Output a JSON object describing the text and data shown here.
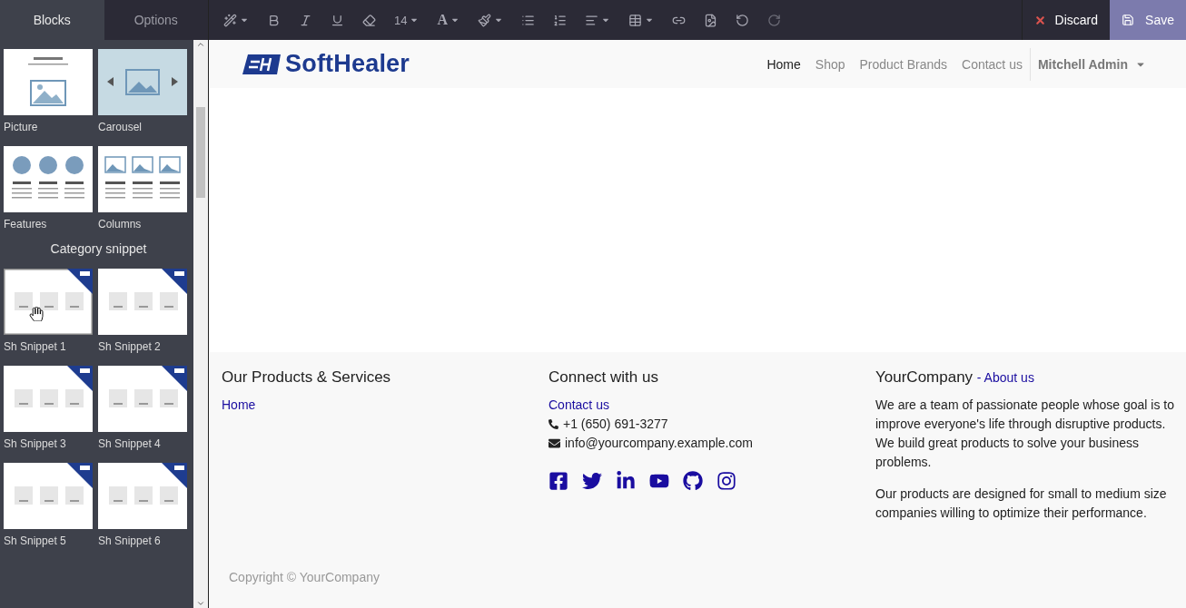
{
  "sidebar": {
    "tabs": [
      {
        "label": "Blocks",
        "selected": true
      },
      {
        "label": "Options",
        "selected": false
      }
    ],
    "groups": [
      {
        "blocks": [
          {
            "label": "Picture",
            "kind": "picture",
            "selected": false
          },
          {
            "label": "Carousel",
            "kind": "carousel",
            "selected": false
          },
          {
            "label": "Features",
            "kind": "features",
            "selected": false
          },
          {
            "label": "Columns",
            "kind": "columns",
            "selected": false
          }
        ]
      },
      {
        "title": "Category snippet",
        "blocks": [
          {
            "label": "Sh Snippet 1",
            "kind": "snippet",
            "selected": true
          },
          {
            "label": "Sh Snippet 2",
            "kind": "snippet",
            "selected": false
          },
          {
            "label": "Sh Snippet 3",
            "kind": "snippet",
            "selected": false
          },
          {
            "label": "Sh Snippet 4",
            "kind": "snippet",
            "selected": false
          },
          {
            "label": "Sh Snippet 5",
            "kind": "snippet",
            "selected": false
          },
          {
            "label": "Sh Snippet 6",
            "kind": "snippet",
            "selected": false
          }
        ]
      }
    ]
  },
  "toolbar": {
    "tools": [
      {
        "kind": "wand",
        "dropdown": true
      },
      {
        "kind": "bold"
      },
      {
        "kind": "italic"
      },
      {
        "kind": "underline"
      },
      {
        "kind": "eraser"
      },
      {
        "kind": "size",
        "label": "14",
        "dropdown": true
      },
      {
        "kind": "font-color",
        "label": "A",
        "dropdown": true
      },
      {
        "kind": "brush",
        "dropdown": true
      },
      {
        "kind": "list"
      },
      {
        "kind": "ordered-list"
      },
      {
        "kind": "align",
        "dropdown": true
      },
      {
        "kind": "table",
        "dropdown": true
      },
      {
        "kind": "link"
      },
      {
        "kind": "image"
      },
      {
        "kind": "undo"
      },
      {
        "kind": "redo",
        "disabled": true
      }
    ],
    "discard": "Discard",
    "save": "Save"
  },
  "site": {
    "brand": "SoftHealer",
    "nav": [
      {
        "label": "Home",
        "selected": true
      },
      {
        "label": "Shop",
        "selected": false
      },
      {
        "label": "Product Brands",
        "selected": false
      },
      {
        "label": "Contact us",
        "selected": false
      }
    ],
    "user": "Mitchell Admin",
    "footer": {
      "columns": [
        {
          "title": "Our Products & Services",
          "links": [
            "Home"
          ]
        },
        {
          "title": "Connect with us",
          "links": [
            "Contact us"
          ],
          "phone": "+1 (650) 691-3277",
          "email": "info@yourcompany.example.com",
          "social": [
            {
              "kind": "facebook"
            },
            {
              "kind": "twitter"
            },
            {
              "kind": "linkedin"
            },
            {
              "kind": "youtube"
            },
            {
              "kind": "github"
            },
            {
              "kind": "instagram"
            }
          ]
        },
        {
          "title": "YourCompany",
          "title_link": "- About us",
          "paragraphs": [
            "We are a team of passionate people whose goal is to improve everyone's life through disruptive products. We build great products to solve your business problems.",
            "Our products are designed for small to medium size companies willing to optimize their performance."
          ]
        }
      ],
      "copyright": "Copyright © YourCompany"
    }
  }
}
